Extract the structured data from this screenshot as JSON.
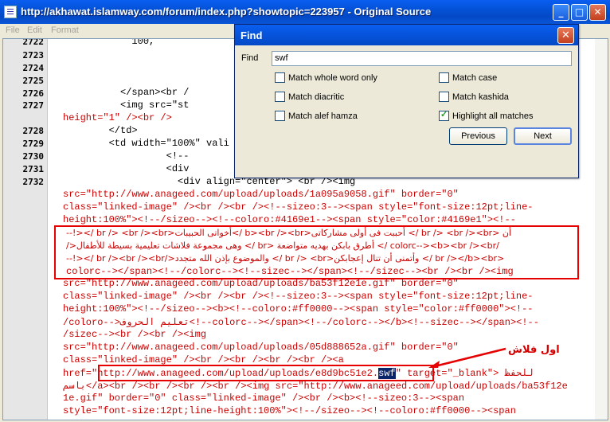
{
  "window": {
    "title": "http://akhawat.islamway.com/forum/index.php?showtopic=223957 - Original Source",
    "minimize": "_",
    "maximize": "□",
    "close": "✕"
  },
  "menu": {
    "file": "File",
    "edit": "Edit",
    "format": "Format"
  },
  "line_numbers": [
    "2722",
    "2723",
    "2724",
    "2725",
    "2726",
    "2727",
    "2728",
    "2729",
    "2730",
    "2731",
    "2732"
  ],
  "code": {
    "l0": "            100,",
    "l2726": "          </span><br /",
    "l2727": "          <img src=\"st",
    "l2727b": "height=\"1\" /><br />",
    "l2728": "        </td>",
    "l2729": "        <td width=\"100%\" vali",
    "l2730": "                  <!--",
    "l2731": "                  <div",
    "l2732": "                    <div align=\"center\"> <br /><img",
    "c1": "src=\"http://www.anageed.com/upload/uploads/1a095a9058.gif\" border=\"0\"",
    "c2": "class=\"linked-image\" /><br /><br /><!--sizeo:3--><span style=\"font-size:12pt;line-",
    "c3": "height:100%\"><!--/sizeo--><!--coloro:#4169e1--><span style=\"color:#4169e1\"><!--",
    "ar1": "أن <br /> <br /><br /> أحببت فى أولى مشاركاتى<b><br /><br />أخواتى الحبيبات<br /> <br /><br /><!--",
    "ar2": "/colorc--><b><br /><br /> أطرق بابكن بهديه متواضعة <br /> وهى مجموعة فلاشات تعليمية بسيطة للأطفال</",
    "ar3": "<br /></b><br /> وأتمنى أن تنال إعجابكن<br /> <br /> والموضوع بإذن الله متجدد</br /><br /><br /><!--",
    "ar4": "colorc--></span><!--/colorc--><!--sizec--></span><!--/sizec--><br /><br /><img",
    "d1": "src=\"http://www.anageed.com/upload/uploads/ba53f12e1e.gif\" border=\"0\"",
    "d2": "class=\"linked-image\" /><br /><br /><!--sizeo:3--><span style=\"font-size:12pt;line-",
    "d3": "height:100%\"><!--/sizeo--><b><!--coloro:#ff0000--><span style=\"color:#ff0000\"><!--",
    "d4": "/coloro-->تعليم الحروف<!--colorc--></span><!--/colorc--></b><!--sizec--></span><!--",
    "d5": "/sizec--><br /><br /><img",
    "d6": "src=\"http://www.anageed.com/upload/uploads/05d888652a.gif\" border=\"0\"",
    "d7": "class=\"linked-image\" /><br /><br /><br /><br /><a",
    "d8a": "href=\"",
    "d8url": "http://www.anageed.com/upload/uploads/e8d9bc51e2.",
    "d8hl": "swf",
    "d8b": "\" target=\"_blank\">",
    "d8c": "للحفظ",
    "d9": "باسم</a><br /><br /><br /><br /><img src=\"http://www.anageed.com/upload/uploads/ba53f12e",
    "d10": "1e.gif\" border=\"0\" class=\"linked-image\" /><br /><b><!--sizeo:3--><span",
    "d11": "style=\"font-size:12pt;line-height:100%\"><!--/sizeo--><!--coloro:#ff0000--><span"
  },
  "annotation": "اول فلاش",
  "find": {
    "title": "Find",
    "label": "Find",
    "value": "swf",
    "options": [
      {
        "label": "Match whole word only",
        "checked": false
      },
      {
        "label": "Match case",
        "checked": false
      },
      {
        "label": "Match diacritic",
        "checked": false
      },
      {
        "label": "Match kashida",
        "checked": false
      },
      {
        "label": "Match alef hamza",
        "checked": false
      },
      {
        "label": "Highlight all matches",
        "checked": true
      }
    ],
    "previous": "Previous",
    "next": "Next"
  },
  "colors": {
    "title_blue": "#0451d6",
    "highlight": "#0a246a",
    "annotation_red": "#e60000",
    "code_red": "#cc0000"
  }
}
